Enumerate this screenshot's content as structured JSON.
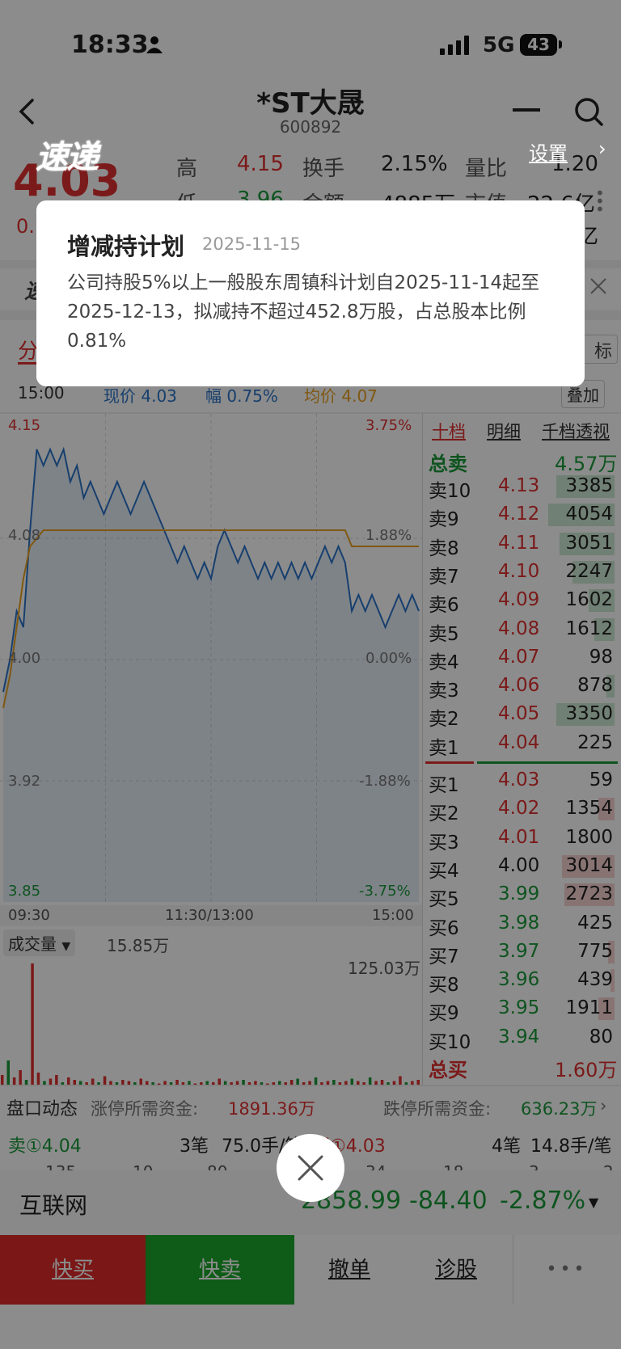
{
  "status_bar": {
    "time": "18:33",
    "network": "5G",
    "battery": "43"
  },
  "header": {
    "title": "*ST大晟",
    "code": "600892"
  },
  "badge": {
    "logo_text": "速递",
    "settings": "设置"
  },
  "quote": {
    "price": "4.03",
    "change_partial": "0.",
    "high_label": "高",
    "high": "4.15",
    "turnover_label": "换手",
    "turnover": "2.15%",
    "vol_ratio_label": "量比",
    "vol_ratio": "1.20",
    "low_label": "低",
    "low": "3.96",
    "amount_label": "金额",
    "amount": "4885万",
    "mcap_label": "市值",
    "mcap": "22.6亿",
    "partial_char": "亿"
  },
  "ticker": {
    "partial": "速"
  },
  "chart_tabs": {
    "fen": "分",
    "zhibiao": "标",
    "diejia": "叠加"
  },
  "chart_info": {
    "time": "15:00",
    "price": "现价 4.03",
    "change": "幅 0.75%",
    "avg": "均价 4.07"
  },
  "chart_data": {
    "type": "line",
    "title": "",
    "ylim": [
      3.85,
      4.15
    ],
    "y_ticks": [
      "4.15",
      "4.08",
      "4.00",
      "3.92",
      "3.85"
    ],
    "pct_ticks": [
      "3.75%",
      "1.88%",
      "0.00%",
      "-1.88%",
      "-3.75%"
    ],
    "x_ticks": [
      "09:30",
      "11:30/13:00",
      "15:00"
    ],
    "series": [
      {
        "values": [
          3.98,
          4.0,
          4.03,
          4.02,
          4.08,
          4.13,
          4.12,
          4.13,
          4.12,
          4.13,
          4.11,
          4.12,
          4.1,
          4.11,
          4.1,
          4.09,
          4.1,
          4.11,
          4.1,
          4.09,
          4.1,
          4.11,
          4.1,
          4.09,
          4.08,
          4.07,
          4.06,
          4.07,
          4.06,
          4.05,
          4.06,
          4.05,
          4.07,
          4.08,
          4.07,
          4.06,
          4.07,
          4.06,
          4.05,
          4.06,
          4.05,
          4.06,
          4.05,
          4.06,
          4.05,
          4.06,
          4.05,
          4.06,
          4.07,
          4.06,
          4.07,
          4.06,
          4.03,
          4.04,
          4.03,
          4.04,
          4.03,
          4.02,
          4.03,
          4.04,
          4.03,
          4.04,
          4.03
        ]
      },
      {
        "values": [
          3.97,
          3.99,
          4.02,
          4.05,
          4.07,
          4.075,
          4.08,
          4.08,
          4.08,
          4.08,
          4.08,
          4.08,
          4.08,
          4.08,
          4.08,
          4.08,
          4.08,
          4.08,
          4.08,
          4.08,
          4.08,
          4.08,
          4.08,
          4.08,
          4.08,
          4.08,
          4.08,
          4.08,
          4.08,
          4.08,
          4.08,
          4.08,
          4.08,
          4.08,
          4.08,
          4.08,
          4.08,
          4.08,
          4.08,
          4.08,
          4.08,
          4.08,
          4.08,
          4.08,
          4.08,
          4.08,
          4.08,
          4.08,
          4.08,
          4.08,
          4.08,
          4.08,
          4.07,
          4.07,
          4.07,
          4.07,
          4.07,
          4.07,
          4.07,
          4.07,
          4.07,
          4.07,
          4.07
        ]
      }
    ],
    "volume_label": "成交量",
    "volume_current": "15.85万",
    "volume_max": "125.03万",
    "volume_bars": [
      8,
      20,
      6,
      12,
      4,
      100,
      10,
      3,
      5,
      8,
      2,
      6,
      4,
      3,
      2,
      5,
      2,
      7,
      3,
      2,
      4,
      3,
      2,
      5,
      3,
      2,
      1,
      3,
      2,
      4,
      2,
      3,
      1,
      2,
      3,
      2,
      5,
      3,
      2,
      3,
      4,
      2,
      3,
      2,
      1,
      2,
      3,
      2,
      4,
      5,
      2,
      3,
      6,
      2,
      3,
      4,
      2,
      3,
      5,
      3,
      2,
      6,
      3,
      4,
      2,
      3,
      7,
      2,
      3,
      4
    ]
  },
  "orderbook": {
    "tabs": [
      "十档",
      "明细",
      "千档透视"
    ],
    "total_sell_label": "总卖",
    "total_sell": "4.57万",
    "total_buy_label": "总买",
    "total_buy": "1.60万",
    "sells": [
      {
        "label": "卖10",
        "price": "4.13",
        "vol": "3385",
        "bar": 0.72
      },
      {
        "label": "卖9",
        "price": "4.12",
        "vol": "4054",
        "bar": 0.82
      },
      {
        "label": "卖8",
        "price": "4.11",
        "vol": "3051",
        "bar": 0.68
      },
      {
        "label": "卖7",
        "price": "4.10",
        "vol": "2247",
        "bar": 0.52
      },
      {
        "label": "卖6",
        "price": "4.09",
        "vol": "1602",
        "bar": 0.32
      },
      {
        "label": "卖5",
        "price": "4.08",
        "vol": "1612",
        "bar": 0.25
      },
      {
        "label": "卖4",
        "price": "4.07",
        "vol": "98",
        "bar": 0.0
      },
      {
        "label": "卖3",
        "price": "4.06",
        "vol": "878",
        "bar": 0.1
      },
      {
        "label": "卖2",
        "price": "4.05",
        "vol": "3350",
        "bar": 0.72
      },
      {
        "label": "卖1",
        "price": "4.04",
        "vol": "225",
        "bar": 0.0
      }
    ],
    "buys": [
      {
        "label": "买1",
        "price": "4.03",
        "vol": "59",
        "bar": 0.0
      },
      {
        "label": "买2",
        "price": "4.02",
        "vol": "1354",
        "bar": 0.2
      },
      {
        "label": "买3",
        "price": "4.01",
        "vol": "1800",
        "bar": 0.0
      },
      {
        "label": "买4",
        "price": "4.00",
        "vol": "3014",
        "bar": 0.65
      },
      {
        "label": "买5",
        "price": "3.99",
        "vol": "2723",
        "bar": 0.62
      },
      {
        "label": "买6",
        "price": "3.98",
        "vol": "425",
        "bar": 0.0
      },
      {
        "label": "买7",
        "price": "3.97",
        "vol": "775",
        "bar": 0.08
      },
      {
        "label": "买8",
        "price": "3.96",
        "vol": "439",
        "bar": 0.05
      },
      {
        "label": "买9",
        "price": "3.95",
        "vol": "1911",
        "bar": 0.2
      },
      {
        "label": "买10",
        "price": "3.94",
        "vol": "80",
        "bar": 0.0
      }
    ]
  },
  "pankou": {
    "label": "盘口动态",
    "limit_up_label": "涨停所需资金:",
    "limit_up": "1891.36万",
    "limit_down_label": "跌停所需资金:",
    "limit_down": "636.23万"
  },
  "trade_line": {
    "sell_label": "卖①4.04",
    "sell_count": "3笔",
    "sell_amount": "75.0手/笔",
    "buy_label": "买①4.03",
    "buy_count": "4笔",
    "buy_amount": "14.8手/笔",
    "partial_nums": [
      "135",
      "10",
      "80",
      "34",
      "18",
      "3",
      "2"
    ]
  },
  "index_bar": {
    "name": "互联网",
    "value": "2858.99",
    "change": "-84.40",
    "pct": "-2.87%"
  },
  "bottom_nav": {
    "buy": "快买",
    "sell": "快卖",
    "cancel": "撤单",
    "diagnose": "诊股",
    "more": "•••"
  },
  "popup": {
    "title": "增减持计划",
    "date": "2025-11-15",
    "body": "公司持股5%以上一般股东周镇科计划自2025-11-14起至2025-12-13，拟减持不超过452.8万股，占总股本比例0.81%"
  },
  "colors": {
    "red": "#e03030",
    "green": "#1a9a3a",
    "line_blue": "#2a73c8",
    "line_orange": "#e8a020",
    "buy_btn": "#e02a2a",
    "sell_btn": "#1aa82a"
  }
}
